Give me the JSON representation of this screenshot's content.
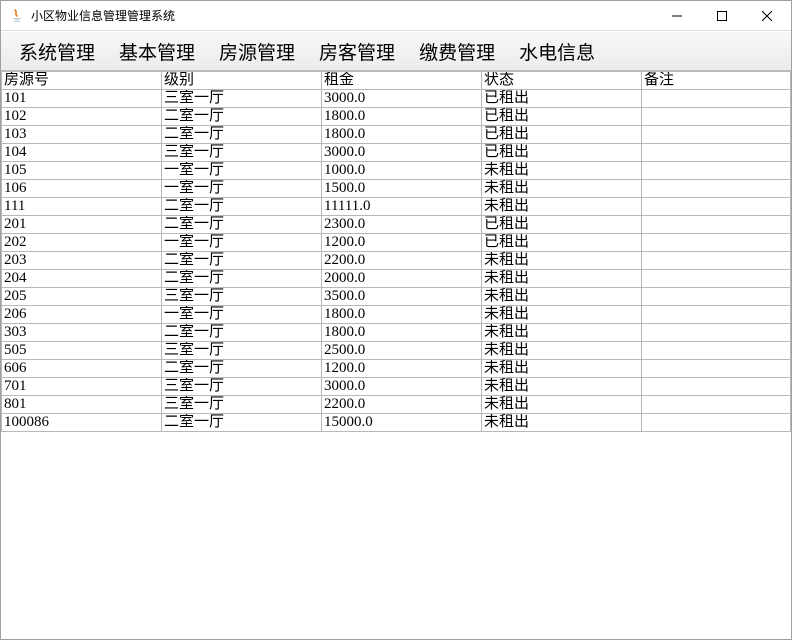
{
  "window": {
    "title": "小区物业信息管理管理系统"
  },
  "menubar": {
    "items": [
      "系统管理",
      "基本管理",
      "房源管理",
      "房客管理",
      "缴费管理",
      "水电信息"
    ]
  },
  "table": {
    "columns": [
      "房源号",
      "级别",
      "租金",
      "状态",
      "备注"
    ],
    "rows": [
      {
        "id": "101",
        "level": "三室一厅",
        "rent": "3000.0",
        "status": "已租出",
        "note": ""
      },
      {
        "id": "102",
        "level": "二室一厅",
        "rent": "1800.0",
        "status": "已租出",
        "note": ""
      },
      {
        "id": "103",
        "level": "二室一厅",
        "rent": "1800.0",
        "status": "已租出",
        "note": ""
      },
      {
        "id": "104",
        "level": "三室一厅",
        "rent": "3000.0",
        "status": "已租出",
        "note": ""
      },
      {
        "id": "105",
        "level": "一室一厅",
        "rent": "1000.0",
        "status": "未租出",
        "note": ""
      },
      {
        "id": "106",
        "level": "一室一厅",
        "rent": "1500.0",
        "status": "未租出",
        "note": ""
      },
      {
        "id": "111",
        "level": "二室一厅",
        "rent": "11111.0",
        "status": "未租出",
        "note": ""
      },
      {
        "id": "201",
        "level": "二室一厅",
        "rent": "2300.0",
        "status": "已租出",
        "note": ""
      },
      {
        "id": "202",
        "level": "一室一厅",
        "rent": "1200.0",
        "status": "已租出",
        "note": ""
      },
      {
        "id": "203",
        "level": "二室一厅",
        "rent": "2200.0",
        "status": "未租出",
        "note": ""
      },
      {
        "id": "204",
        "level": "二室一厅",
        "rent": "2000.0",
        "status": "未租出",
        "note": ""
      },
      {
        "id": "205",
        "level": "三室一厅",
        "rent": "3500.0",
        "status": "未租出",
        "note": ""
      },
      {
        "id": "206",
        "level": "一室一厅",
        "rent": "1800.0",
        "status": "未租出",
        "note": ""
      },
      {
        "id": "303",
        "level": "二室一厅",
        "rent": "1800.0",
        "status": "未租出",
        "note": ""
      },
      {
        "id": "505",
        "level": "三室一厅",
        "rent": "2500.0",
        "status": "未租出",
        "note": ""
      },
      {
        "id": "606",
        "level": "二室一厅",
        "rent": "1200.0",
        "status": "未租出",
        "note": ""
      },
      {
        "id": "701",
        "level": "三室一厅",
        "rent": "3000.0",
        "status": "未租出",
        "note": ""
      },
      {
        "id": "801",
        "level": "三室一厅",
        "rent": "2200.0",
        "status": "未租出",
        "note": ""
      },
      {
        "id": "100086",
        "level": "二室一厅",
        "rent": "15000.0",
        "status": "未租出",
        "note": ""
      }
    ]
  }
}
